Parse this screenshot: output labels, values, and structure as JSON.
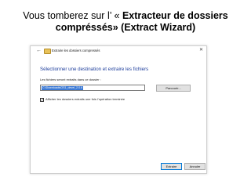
{
  "slide": {
    "title_prefix": "Vous tomberez sur l’ « ",
    "title_bold": "Extracteur de dossiers compréssés» (Extract Wizard)"
  },
  "dialog": {
    "window_title": "Extraire les dossiers compressés",
    "heading": "Sélectionner une destination et extraire les fichiers",
    "field_label": "Les fichiers seront extraits dans ce dossier :",
    "path_value": "C:\\Downloads\\OS1_devel_2.0.6",
    "browse_label": "Parcourir...",
    "show_files_label": "Afficher les dossiers extraits une fois l’opération terminée",
    "show_files_checked": true,
    "extract_label": "Extraire",
    "cancel_label": "Annuler"
  },
  "icons": {
    "back": "back-arrow-icon",
    "folder": "zip-folder-icon",
    "close": "close-icon"
  }
}
